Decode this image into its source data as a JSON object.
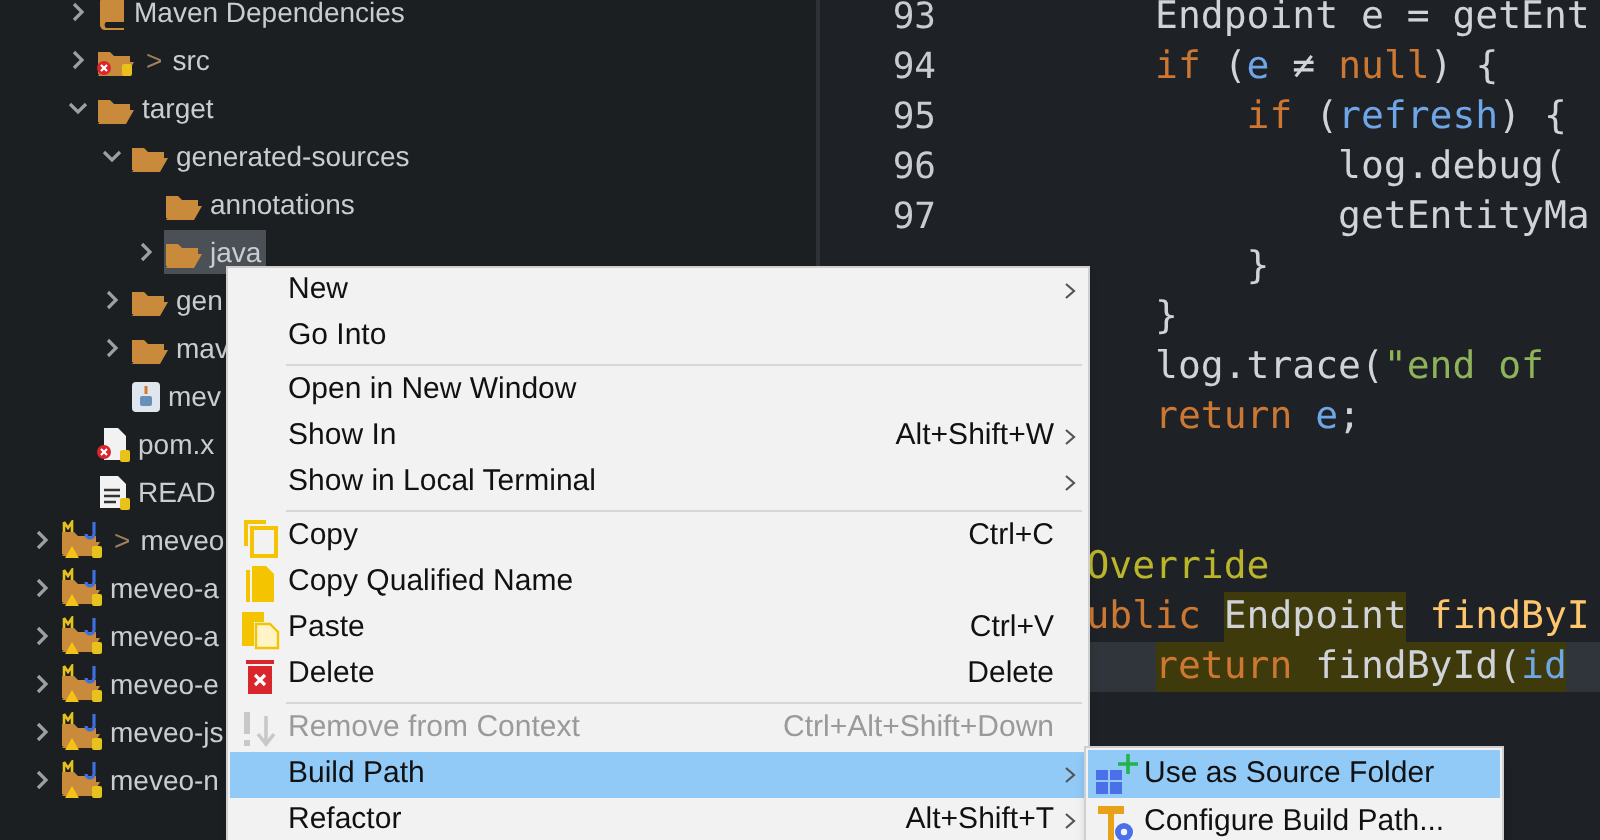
{
  "tree": {
    "parent_children": [
      {
        "label": "Maven Dependencies",
        "kind": "library",
        "expanded": false,
        "selected": false
      },
      {
        "label": "src",
        "prefix": ">",
        "kind": "source-folder",
        "expanded": false,
        "selected": false
      },
      {
        "label": "target",
        "kind": "folder",
        "expanded": true,
        "selected": false,
        "children": [
          {
            "label": "generated-sources",
            "kind": "folder",
            "expanded": true,
            "selected": false,
            "children": [
              {
                "label": "annotations",
                "kind": "folder",
                "selected": false
              },
              {
                "label": "java",
                "kind": "folder",
                "expanded": false,
                "selected": true
              }
            ]
          },
          {
            "label": "gen",
            "kind": "folder",
            "expanded": false,
            "selected": false
          },
          {
            "label": "mav",
            "kind": "folder",
            "expanded": false,
            "selected": false
          },
          {
            "label": "mev",
            "kind": "java-file",
            "selected": false
          }
        ]
      },
      {
        "label": "pom.x",
        "kind": "xml-file",
        "selected": false
      },
      {
        "label": "READ",
        "kind": "text-file",
        "selected": false
      }
    ],
    "items": [
      {
        "label": "meveo",
        "prefix": ">",
        "kind": "project",
        "expanded": false,
        "selected": false
      },
      {
        "label": "meveo-a",
        "kind": "project",
        "expanded": false,
        "selected": false
      },
      {
        "label": "meveo-a",
        "kind": "project",
        "expanded": false,
        "selected": false
      },
      {
        "label": "meveo-e",
        "kind": "project",
        "expanded": false,
        "selected": false
      },
      {
        "label": "meveo-js",
        "kind": "project",
        "expanded": false,
        "selected": false
      },
      {
        "label": "meveo-n",
        "kind": "project",
        "expanded": false,
        "selected": false
      }
    ]
  },
  "editor": {
    "lines": [
      {
        "number": "93",
        "tokens": [
          {
            "text": "Endpoint e = getEnt",
            "kind": "plain"
          }
        ]
      },
      {
        "number": "94",
        "tokens": [
          {
            "text": "if",
            "kind": "keyword"
          },
          {
            "text": " (",
            "kind": "plain"
          },
          {
            "text": "e",
            "kind": "variable"
          },
          {
            "text": " ≠ ",
            "kind": "plain"
          },
          {
            "text": "null",
            "kind": "keyword"
          },
          {
            "text": ") {",
            "kind": "plain"
          }
        ]
      },
      {
        "number": "95",
        "tokens": [
          {
            "text": "if",
            "kind": "keyword"
          },
          {
            "text": " (",
            "kind": "plain"
          },
          {
            "text": "refresh",
            "kind": "variable"
          },
          {
            "text": ") {",
            "kind": "plain"
          }
        ]
      },
      {
        "number": "96",
        "tokens": [
          {
            "text": "log.debug(",
            "kind": "plain"
          }
        ]
      },
      {
        "number": "97",
        "tokens": [
          {
            "text": "getEntityMa",
            "kind": "plain"
          }
        ]
      },
      {
        "tokens": [
          {
            "text": "}",
            "kind": "plain"
          }
        ]
      },
      {
        "tokens": [
          {
            "text": "}",
            "kind": "plain"
          }
        ]
      },
      {
        "tokens": [
          {
            "text": "log.trace(",
            "kind": "plain"
          },
          {
            "text": "\"end of ",
            "kind": "string"
          }
        ]
      },
      {
        "tokens": [
          {
            "text": "return ",
            "kind": "keyword"
          },
          {
            "text": "e",
            "kind": "variable"
          },
          {
            "text": ";",
            "kind": "plain"
          }
        ]
      },
      {
        "tokens": [
          {
            "text": "Override",
            "kind": "annotation"
          }
        ]
      },
      {
        "tokens": [
          {
            "text": "ublic ",
            "kind": "keyword"
          },
          {
            "text": "Endpoint",
            "kind": "plain",
            "highlighted": true
          },
          {
            "text": " findByI",
            "kind": "method",
            "highlighted": false
          }
        ]
      },
      {
        "current": true,
        "tokens": [
          {
            "text": "return",
            "kind": "keyword",
            "highlighted": true
          },
          {
            "text": " findById(",
            "kind": "plain",
            "highlighted": true
          },
          {
            "text": "id",
            "kind": "variable",
            "highlighted": true
          }
        ]
      }
    ]
  },
  "context_menu": {
    "items": [
      {
        "kind": "item",
        "label": "New",
        "submenu": true,
        "disabled": false,
        "selected": false
      },
      {
        "kind": "item",
        "label": "Go Into",
        "submenu": false,
        "disabled": false,
        "selected": false
      },
      {
        "kind": "separator"
      },
      {
        "kind": "item",
        "label": "Open in New Window",
        "submenu": false,
        "disabled": false,
        "selected": false
      },
      {
        "kind": "item",
        "label": "Show In",
        "shortcut": "Alt+Shift+W",
        "submenu": true,
        "disabled": false,
        "selected": false
      },
      {
        "kind": "item",
        "label": "Show in Local Terminal",
        "submenu": true,
        "disabled": false,
        "selected": false
      },
      {
        "kind": "separator"
      },
      {
        "kind": "item",
        "label": "Copy",
        "shortcut": "Ctrl+C",
        "submenu": false,
        "disabled": false,
        "selected": false
      },
      {
        "kind": "item",
        "label": "Copy Qualified Name",
        "submenu": false,
        "disabled": false,
        "selected": false
      },
      {
        "kind": "item",
        "label": "Paste",
        "shortcut": "Ctrl+V",
        "submenu": false,
        "disabled": false,
        "selected": false
      },
      {
        "kind": "item",
        "label": "Delete",
        "shortcut": "Delete",
        "submenu": false,
        "disabled": false,
        "selected": false
      },
      {
        "kind": "separator"
      },
      {
        "kind": "item",
        "label": "Remove from Context",
        "shortcut": "Ctrl+Alt+Shift+Down",
        "submenu": false,
        "disabled": true,
        "selected": false
      },
      {
        "kind": "item",
        "label": "Build Path",
        "submenu": true,
        "disabled": false,
        "selected": true
      },
      {
        "kind": "item",
        "label": "Refactor",
        "shortcut": "Alt+Shift+T",
        "submenu": true,
        "disabled": false,
        "selected": false
      }
    ]
  },
  "submenu": {
    "items": [
      {
        "label": "Use as Source Folder",
        "selected": true
      },
      {
        "label": "Configure Build Path...",
        "selected": false
      }
    ]
  }
}
